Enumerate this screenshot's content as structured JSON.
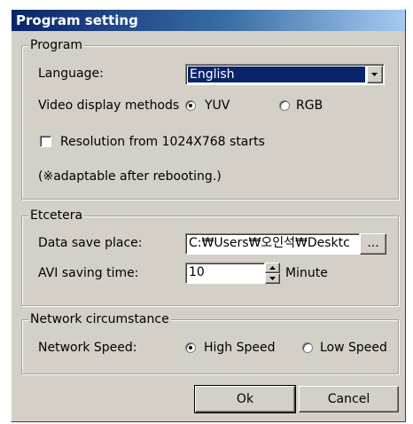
{
  "window": {
    "title": "Program setting"
  },
  "program": {
    "legend": "Program",
    "language_label": "Language:",
    "language_value": "English",
    "video_label": "Video display methods",
    "yuv_label": "YUV",
    "rgb_label": "RGB",
    "selected_method": "YUV",
    "resolution_label": "Resolution from 1024X768 starts",
    "resolution_checked": false,
    "note": "(※adaptable after rebooting.)"
  },
  "etcetera": {
    "legend": "Etcetera",
    "save_place_label": "Data save place:",
    "save_place_value": "C:₩Users₩오인석₩Desktc",
    "browse_label": "...",
    "avi_label": "AVI saving time:",
    "avi_value": "10",
    "avi_unit": "Minute"
  },
  "network": {
    "legend": "Network circumstance",
    "speed_label": "Network Speed:",
    "high_label": "High Speed",
    "low_label": "Low Speed",
    "selected_speed": "High Speed"
  },
  "buttons": {
    "ok": "Ok",
    "cancel": "Cancel"
  },
  "colors": {
    "face": "#d4d0c8",
    "title_start": "#0a246a",
    "title_end": "#a6caf0",
    "selection": "#0a246a"
  }
}
